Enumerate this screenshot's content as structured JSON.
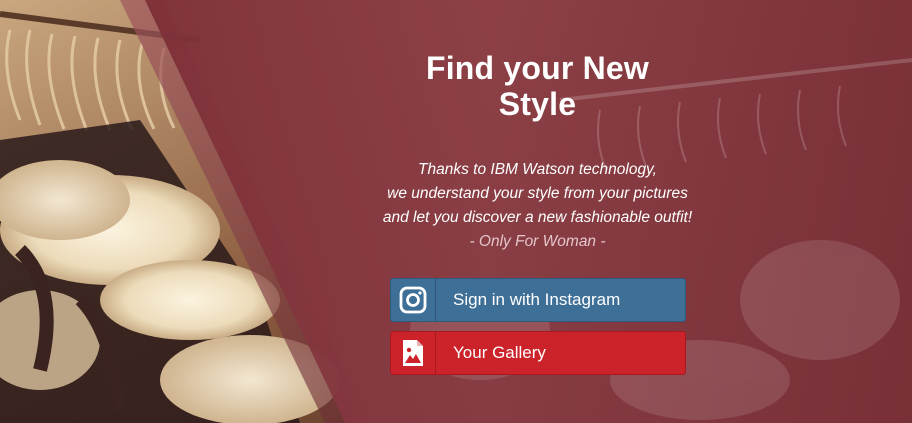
{
  "hero": {
    "title_line1": "Find your New",
    "title_line2": "Style",
    "subtitle_line1": "Thanks to IBM Watson technology,",
    "subtitle_line2": "we understand your style from your pictures",
    "subtitle_line3": "and let you discover a new fashionable outfit!",
    "note": "- Only For Woman -"
  },
  "buttons": {
    "instagram_label": "Sign in with Instagram",
    "instagram_icon": "instagram-icon",
    "gallery_label": "Your Gallery",
    "gallery_icon": "image-icon"
  },
  "colors": {
    "overlay": "#7a3039",
    "instagram": "#3e6f97",
    "gallery": "#cc2229"
  }
}
